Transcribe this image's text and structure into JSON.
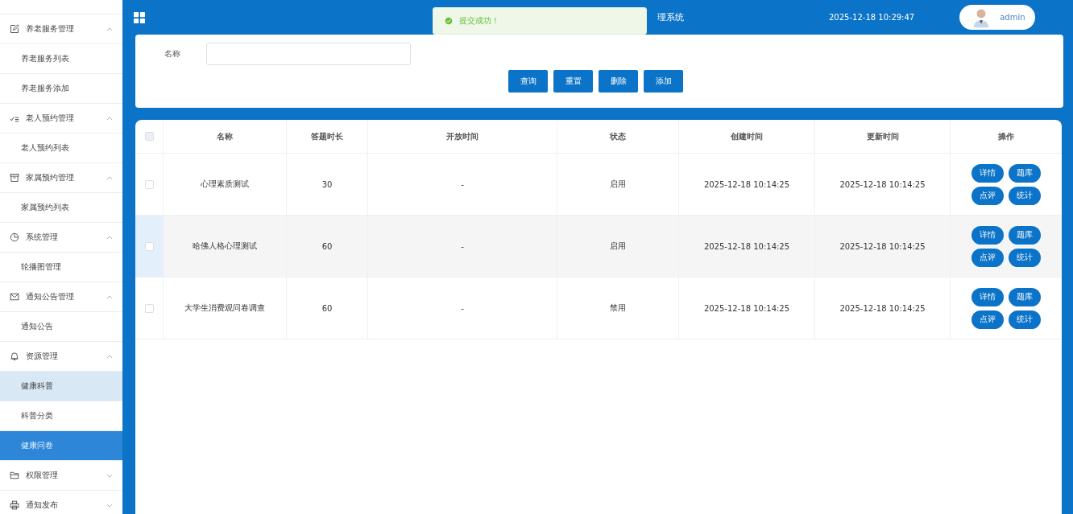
{
  "sidebar": {
    "items": [
      {
        "kind": "group",
        "label": "养老服务管理",
        "expanded": true,
        "children": [
          {
            "label": "养老服务列表",
            "selected": false,
            "hovered": false
          },
          {
            "label": "养老服务添加",
            "selected": false,
            "hovered": false
          }
        ]
      },
      {
        "kind": "group",
        "label": "老人预约管理",
        "expanded": true,
        "children": [
          {
            "label": "老人预约列表",
            "selected": false,
            "hovered": false
          }
        ]
      },
      {
        "kind": "group",
        "label": "家属预约管理",
        "expanded": true,
        "children": [
          {
            "label": "家属预约列表",
            "selected": false,
            "hovered": false
          }
        ]
      },
      {
        "kind": "group",
        "label": "系统管理",
        "expanded": true,
        "children": [
          {
            "label": "轮播图管理",
            "selected": false,
            "hovered": false
          }
        ]
      },
      {
        "kind": "group",
        "label": "通知公告管理",
        "expanded": true,
        "children": [
          {
            "label": "通知公告",
            "selected": false,
            "hovered": false
          }
        ]
      },
      {
        "kind": "group",
        "label": "资源管理",
        "expanded": true,
        "children": [
          {
            "label": "健康科普",
            "selected": false,
            "hovered": true
          },
          {
            "label": "科普分类",
            "selected": false,
            "hovered": false
          },
          {
            "label": "健康问卷",
            "selected": true,
            "hovered": false
          }
        ]
      },
      {
        "kind": "group",
        "label": "权限管理",
        "expanded": false
      },
      {
        "kind": "group",
        "label": "通知发布",
        "expanded": false
      }
    ]
  },
  "header": {
    "title": "理系统",
    "datetime": "2025-12-18 10:29:47",
    "user": "admin"
  },
  "toast": {
    "message": "提交成功！"
  },
  "search": {
    "label": "名称",
    "buttons": [
      "查询",
      "重置",
      "删除",
      "添加"
    ]
  },
  "table": {
    "columns": [
      "名称",
      "答题时长",
      "开放时间",
      "状态",
      "创建时间",
      "更新时间",
      "操作"
    ],
    "all_checked": false,
    "rows": [
      {
        "checked": false,
        "hovered": false,
        "cells": [
          "心理素质测试",
          "30",
          "-",
          "启用",
          "2025-12-18 10:14:25",
          "2025-12-18 10:14:25"
        ],
        "actions": [
          "详情",
          "题库",
          "点评",
          "统计"
        ]
      },
      {
        "checked": false,
        "hovered": true,
        "cells": [
          "哈佛人格心理测试",
          "60",
          "-",
          "启用",
          "2025-12-18 10:14:25",
          "2025-12-18 10:14:25"
        ],
        "actions": [
          "详情",
          "题库",
          "点评",
          "统计"
        ]
      },
      {
        "checked": false,
        "hovered": false,
        "cells": [
          "大学生消费观问卷调查",
          "60",
          "-",
          "禁用",
          "2025-12-18 10:14:25",
          "2025-12-18 10:14:25"
        ],
        "actions": [
          "详情",
          "题库",
          "点评",
          "统计"
        ]
      }
    ]
  }
}
